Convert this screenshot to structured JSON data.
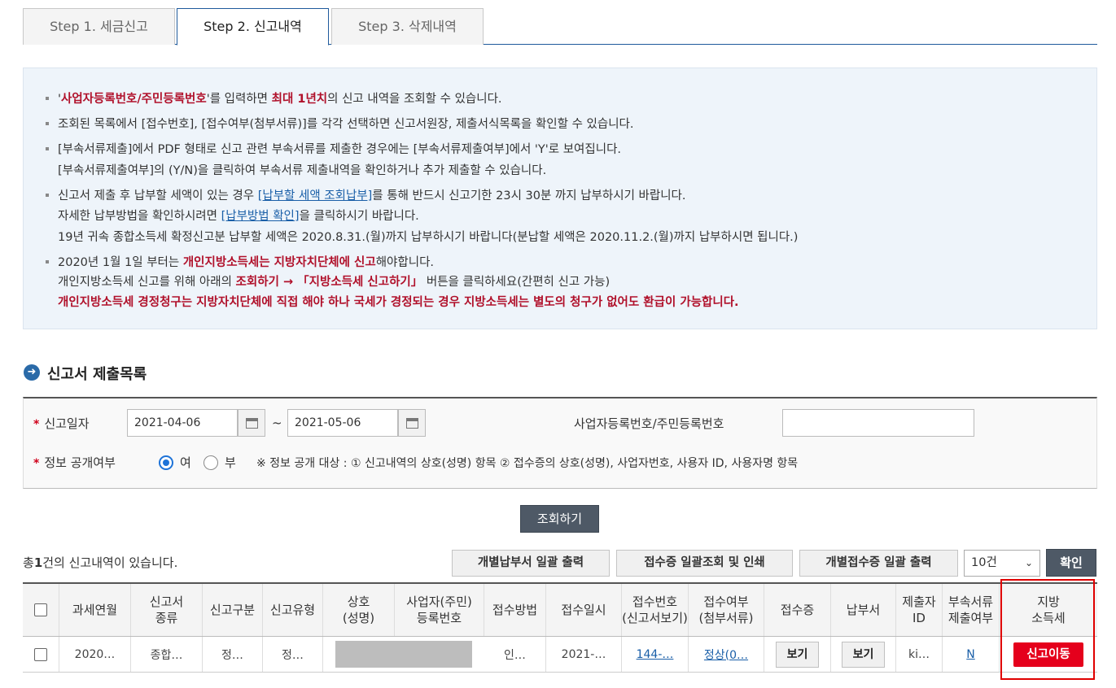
{
  "tabs": [
    {
      "label": "Step 1. 세금신고",
      "active": false
    },
    {
      "label": "Step 2. 신고내역",
      "active": true
    },
    {
      "label": "Step 3. 삭제내역",
      "active": false
    }
  ],
  "info": {
    "l1a": "'",
    "l1b": "사업자등록번호/주민등록번호",
    "l1c": "'를 입력하면 ",
    "l1d": "최대 1년치",
    "l1e": "의 신고 내역을 조회할 수 있습니다.",
    "l2": "조회된 목록에서 [접수번호], [접수여부(첨부서류)]를 각각 선택하면 신고서원장, 제출서식목록을 확인할 수 있습니다.",
    "l3": "[부속서류제출]에서 PDF 형태로 신고 관련 부속서류를 제출한 경우에는 [부속서류제출여부]에서 'Y'로 보여집니다.",
    "l4": "[부속서류제출여부]의 (Y/N)을 클릭하여 부속서류 제출내역을 확인하거나 추가 제출할 수 있습니다.",
    "l5a": "신고서 제출 후 납부할 세액이 있는 경우 ",
    "l5b": "[납부할 세액 조회납부]",
    "l5c": "를 통해 반드시 신고기한 23시 30분 까지 납부하시기 바랍니다.",
    "l6a": "자세한 납부방법을 확인하시려면 ",
    "l6b": "[납부방법 확인]",
    "l6c": "을 클릭하시기 바랍니다.",
    "l7": "19년 귀속 종합소득세 확정신고분 납부할 세액은 2020.8.31.(월)까지 납부하시기 바랍니다(분납할 세액은 2020.11.2.(월)까지 납부하시면 됩니다.)",
    "l8a": "2020년 1월 1일 부터는 ",
    "l8b": "개인지방소득세는 지방자치단체에 신고",
    "l8c": "해야합니다.",
    "l9a": "개인지방소득세 신고를 위해 아래의 ",
    "l9b": "조회하기 → 「지방소득세 신고하기」",
    "l9c": " 버튼을 클릭하세요(간편히 신고 가능)",
    "l10": "개인지방소득세 경정청구는 지방자치단체에 직접 해야 하나 국세가 경정되는 경우 지방소득세는 별도의 청구가 없어도 환급이 가능합니다."
  },
  "section_title": "신고서 제출목록",
  "section_icon": "arrow-right-circle-icon",
  "search": {
    "date_label": "신고일자",
    "required_mark": "*",
    "date_from": "2021-04-06",
    "date_sep": "~",
    "date_to": "2021-05-06",
    "id_label": "사업자등록번호/주민등록번호",
    "id_value": "",
    "public_label": "정보 공개여부",
    "public_yes": "여",
    "public_no": "부",
    "public_selected": "여",
    "public_note": "※ 정보 공개 대상 : ① 신고내역의 상호(성명) 항목 ② 접수증의 상호(성명), 사업자번호, 사용자 ID, 사용자명 항목"
  },
  "search_button": "조회하기",
  "total": {
    "prefix": "총",
    "count": "1",
    "suffix": "건의 신고내역이 있습니다."
  },
  "actions": {
    "bulk_payment_print": "개별납부서 일괄 출력",
    "bulk_receipt_view": "접수증 일괄조회 및 인쇄",
    "individual_receipt_print": "개별접수증 일괄 출력",
    "page_size": "10건",
    "confirm": "확인"
  },
  "table": {
    "headers": [
      "",
      "과세연월",
      "신고서\n종류",
      "신고구분",
      "신고유형",
      "상호\n(성명)",
      "사업자(주민)\n등록번호",
      "접수방법",
      "접수일시",
      "접수번호\n(신고서보기)",
      "접수여부\n(첨부서류)",
      "접수증",
      "납부서",
      "제출자\nID",
      "부속서류\n제출여부",
      "지방\n소득세"
    ],
    "rows": [
      {
        "period": "2020…",
        "form_type": "종합…",
        "category": "정…",
        "report_type": "정…",
        "name": "",
        "reg_no": "",
        "method": "인…",
        "datetime": "2021-…",
        "receipt_no": "144-…",
        "status": "정상(0…",
        "receipt_btn": "보기",
        "payment_btn": "보기",
        "submitter_id": "ki…",
        "attach": "N",
        "local_tax_btn": "신고이동"
      }
    ]
  },
  "colors": {
    "accent": "#1f5a9c",
    "highlight": "#b0102a",
    "red_button": "#e5001c",
    "dark_button": "#4e5966"
  }
}
